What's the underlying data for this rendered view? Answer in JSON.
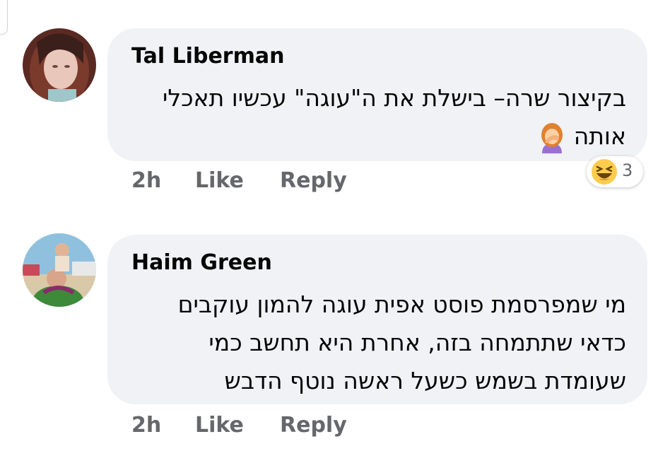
{
  "comments": [
    {
      "author": "Tal Liberman",
      "text_line1": "בקיצור שרה– בישלת את ה\"עוגה\" עכשיו תאכלי",
      "text_line2": "אותה",
      "inline_emoji": "woman-facepalming-icon",
      "time": "2h",
      "like_label": "Like",
      "reply_label": "Reply",
      "reaction": {
        "icon": "laughing-face-icon",
        "count": "3"
      }
    },
    {
      "author": "Haim Green",
      "text_line1": "מי שמפרסמת פוסט אפית עוגה להמון עוקבים",
      "text_line2": "כדאי שתתמחה בזה, אחרת היא תחשב כמי",
      "text_line3": "שעומדת בשמש כשעל ראשה נוטף הדבש",
      "time": "2h",
      "like_label": "Like",
      "reply_label": "Reply"
    }
  ],
  "colors": {
    "bubble": "#f0f2f5",
    "name": "#050505",
    "meta": "#65676b",
    "emoji_yellow": "#ffcc4d"
  }
}
